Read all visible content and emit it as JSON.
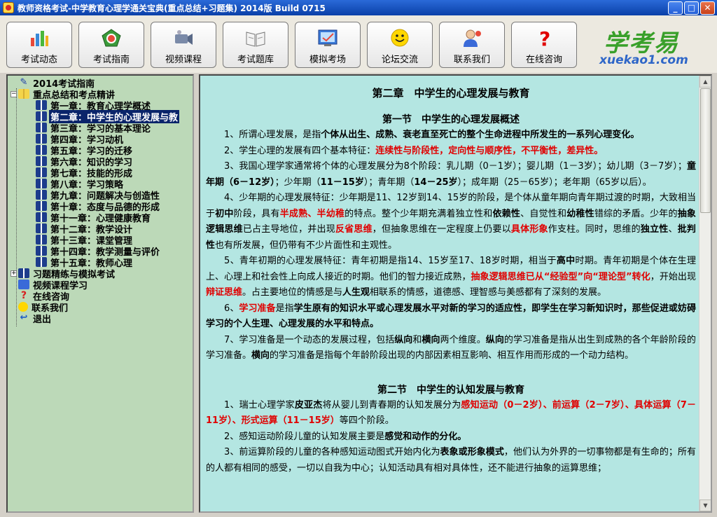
{
  "window": {
    "title": "教师资格考试-中学教育心理学通关宝典(重点总结+习题集) 2014版 Build 0715"
  },
  "toolbar": [
    {
      "label": "考试动态",
      "icon": "bar-chart-icon"
    },
    {
      "label": "考试指南",
      "icon": "compass-icon"
    },
    {
      "label": "视频课程",
      "icon": "video-camera-icon"
    },
    {
      "label": "考试题库",
      "icon": "open-book-icon"
    },
    {
      "label": "模拟考场",
      "icon": "exam-screen-icon"
    },
    {
      "label": "论坛交流",
      "icon": "smiley-icon"
    },
    {
      "label": "联系我们",
      "icon": "contact-person-icon"
    },
    {
      "label": "在线咨询",
      "icon": "question-mark-icon"
    }
  ],
  "logo": {
    "cn": "学考易",
    "en": "xuekao1.com"
  },
  "tree": [
    {
      "label": "2014考试指南",
      "level": 0,
      "icon": "guide"
    },
    {
      "label": "重点总结和考点精讲",
      "level": 0,
      "icon": "book-open",
      "expander": "−"
    },
    {
      "label": "第一章：教育心理学概述",
      "level": 1,
      "icon": "book"
    },
    {
      "label": "第二章：中学生的心理发展与教",
      "level": 1,
      "icon": "book",
      "selected": true
    },
    {
      "label": "第三章：学习的基本理论",
      "level": 1,
      "icon": "book"
    },
    {
      "label": "第四章：学习动机",
      "level": 1,
      "icon": "book"
    },
    {
      "label": "第五章：学习的迁移",
      "level": 1,
      "icon": "book"
    },
    {
      "label": "第六章：知识的学习",
      "level": 1,
      "icon": "book"
    },
    {
      "label": "第七章：技能的形成",
      "level": 1,
      "icon": "book"
    },
    {
      "label": "第八章：学习策略",
      "level": 1,
      "icon": "book"
    },
    {
      "label": "第九章：问题解决与创造性",
      "level": 1,
      "icon": "book"
    },
    {
      "label": "第十章：态度与品德的形成",
      "level": 1,
      "icon": "book"
    },
    {
      "label": "第十一章：心理健康教育",
      "level": 1,
      "icon": "book"
    },
    {
      "label": "第十二章：教学设计",
      "level": 1,
      "icon": "book"
    },
    {
      "label": "第十三章：课堂管理",
      "level": 1,
      "icon": "book"
    },
    {
      "label": "第十四章：教学测量与评价",
      "level": 1,
      "icon": "book"
    },
    {
      "label": "第十五章：教师心理",
      "level": 1,
      "icon": "book"
    },
    {
      "label": "习题精练与模拟考试",
      "level": 0,
      "icon": "book",
      "expander": "+"
    },
    {
      "label": "视频课程学习",
      "level": 0,
      "icon": "video"
    },
    {
      "label": "在线咨询",
      "level": 0,
      "icon": "help"
    },
    {
      "label": "联系我们",
      "level": 0,
      "icon": "smile"
    },
    {
      "label": "退出",
      "level": 0,
      "icon": "exit"
    }
  ],
  "content": {
    "chapter_title": "第二章　中学生的心理发展与教育",
    "blocks": [
      {
        "type": "h2",
        "text": "第一节　中学生的心理发展概述"
      },
      {
        "type": "p",
        "runs": [
          {
            "t": "1、所谓心理发展，是指"
          },
          {
            "t": "个体从出生、成熟、衰老直至死亡的整个生命进程中所发生的一系列心理变化。",
            "s": "b"
          }
        ]
      },
      {
        "type": "p",
        "runs": [
          {
            "t": "2、学生心理的发展有四个基本特征："
          },
          {
            "t": "连续性与阶段性，定向性与顺序性，不平衡性，差异性。",
            "s": "r"
          }
        ]
      },
      {
        "type": "p",
        "runs": [
          {
            "t": "3、我国心理学家通常将个体的心理发展分为8个阶段：乳儿期（0－1岁）；婴儿期（1－3岁）；幼儿期（3－7岁）；"
          },
          {
            "t": "童年期（6－12岁）",
            "s": "b"
          },
          {
            "t": "；少年期（"
          },
          {
            "t": "11－15岁",
            "s": "b"
          },
          {
            "t": "）；青年期（"
          },
          {
            "t": "14－25岁",
            "s": "b"
          },
          {
            "t": "）；成年期（25－65岁）；老年期（65岁以后）。"
          }
        ]
      },
      {
        "type": "p",
        "runs": [
          {
            "t": "4、少年期的心理发展特征：少年期是11、12岁到14、15岁的阶段，是个体从童年期向青年期过渡的时期，大致相当于"
          },
          {
            "t": "初中",
            "s": "b"
          },
          {
            "t": "阶段，具有"
          },
          {
            "t": "半成熟、半幼稚",
            "s": "r"
          },
          {
            "t": "的特点。整个少年期充满着独立性和"
          },
          {
            "t": "依赖性",
            "s": "b"
          },
          {
            "t": "、自觉性和"
          },
          {
            "t": "幼稚性",
            "s": "b"
          },
          {
            "t": "错综的矛盾。少年的"
          },
          {
            "t": "抽象逻辑思维",
            "s": "b"
          },
          {
            "t": "已占主导地位，并出现"
          },
          {
            "t": "反省思维",
            "s": "r"
          },
          {
            "t": "，但抽象思维在一定程度上仍要以"
          },
          {
            "t": "具体形象",
            "s": "r"
          },
          {
            "t": "作支柱。同时，思维的"
          },
          {
            "t": "独立性",
            "s": "b"
          },
          {
            "t": "、"
          },
          {
            "t": "批判性",
            "s": "b"
          },
          {
            "t": "也有所发展，但仍带有不少片面性和主观性。"
          }
        ]
      },
      {
        "type": "p",
        "runs": [
          {
            "t": "5、青年初期的心理发展特征：青年初期是指14、15岁至17、18岁时期，相当于"
          },
          {
            "t": "高中",
            "s": "b"
          },
          {
            "t": "时期。青年初期是个体在生理上、心理上和社会性上向成人接近的时期。他们的智力接近成熟，"
          },
          {
            "t": "抽象逻辑思维已从“经验型”向“理论型”转化",
            "s": "r"
          },
          {
            "t": "，开始出现"
          },
          {
            "t": "辩证思维",
            "s": "r"
          },
          {
            "t": "。占主要地位的情感是与"
          },
          {
            "t": "人生观",
            "s": "b"
          },
          {
            "t": "相联系的情感，道德感、理智感与美感都有了深刻的发展。"
          }
        ]
      },
      {
        "type": "p",
        "runs": [
          {
            "t": "6、"
          },
          {
            "t": "学习准备",
            "s": "r"
          },
          {
            "t": "是指"
          },
          {
            "t": "学生原有的知识水平或心理发展水平对新的学习的适应性，即学生在学习新知识时，那些促进或妨碍学习的个人生理、心理发展的水平和特点。",
            "s": "b"
          }
        ]
      },
      {
        "type": "p",
        "runs": [
          {
            "t": "7、学习准备是一个动态的发展过程，包括"
          },
          {
            "t": "纵向",
            "s": "b"
          },
          {
            "t": "和"
          },
          {
            "t": "横向",
            "s": "b"
          },
          {
            "t": "两个维度。"
          },
          {
            "t": "纵向",
            "s": "b"
          },
          {
            "t": "的学习准备是指从出生到成熟的各个年龄阶段的学习准备。"
          },
          {
            "t": "横向",
            "s": "b"
          },
          {
            "t": "的学习准备是指每个年龄阶段出现的内部因素相互影响、相互作用而形成的一个动力结构。"
          }
        ]
      },
      {
        "type": "gap"
      },
      {
        "type": "h2",
        "text": "第二节　中学生的认知发展与教育"
      },
      {
        "type": "p",
        "runs": [
          {
            "t": "1、瑞士心理学家"
          },
          {
            "t": "皮亚杰",
            "s": "b"
          },
          {
            "t": "将从婴儿到青春期的认知发展分为"
          },
          {
            "t": "感知运动（0－2岁）、前运算（2－7岁）、具体运算（7－11岁）、形式运算（11－15岁）",
            "s": "r"
          },
          {
            "t": "等四个阶段。"
          }
        ]
      },
      {
        "type": "p",
        "runs": [
          {
            "t": "2、感知运动阶段儿童的认知发展主要是"
          },
          {
            "t": "感觉和动作的分化。",
            "s": "b"
          }
        ]
      },
      {
        "type": "p",
        "runs": [
          {
            "t": "3、前运算阶段的儿童的各种感知运动图式开始内化为"
          },
          {
            "t": "表象或形象模式",
            "s": "b"
          },
          {
            "t": "，他们认为外界的一切事物都是有生命的；所有的人都有相同的感受，一切以自我为中心；认知活动具有相对具体性，还不能进行抽象的运算思维；"
          }
        ]
      }
    ]
  },
  "scrollbar": {
    "position": 0.0,
    "up_arrow": "▲",
    "down_arrow": "▼"
  },
  "window_buttons": {
    "minimize": "_",
    "maximize": "□",
    "close": "✕"
  }
}
